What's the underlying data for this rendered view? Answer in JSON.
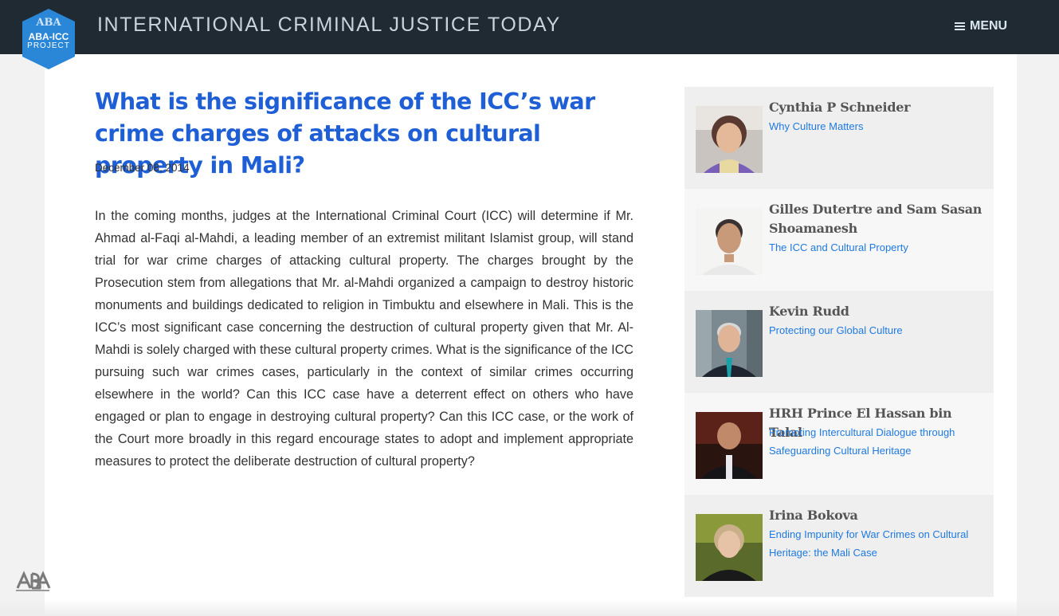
{
  "header": {
    "site_title": "INTERNATIONAL CRIMINAL JUSTICE TODAY",
    "menu_label": "MENU",
    "logo": {
      "line1": "ABA-ICC",
      "line2": "PROJECT"
    }
  },
  "article": {
    "title": "What is the significance of the ICC’s war crime charges of attacks on cultural property in Mali?",
    "date": "December 08, 2014",
    "body": "In the coming months, judges at the International Criminal Court (ICC) will determine if Mr. Ahmad al-Faqi al-Mahdi, a leading member of an extremist militant Islamist group, will stand trial for war crime charges of attacking cultural property. The charges brought by the Prosecution stem from allegations that Mr. al-Mahdi organized a campaign to destroy historic monuments and buildings dedicated to religion in Timbuktu and elsewhere in Mali. This is the ICC’s most significant case concerning the destruction of cultural property given that Mr. Al-Mahdi is solely charged with these cultural property crimes. What is the significance of the ICC pursuing such war crimes cases, particularly in the context of similar crimes occurring elsewhere in the world? Can this ICC case have a deterrent effect on others who have engaged or plan to engage in destroying cultural property?  Can this ICC case, or the work of the Court more broadly in this regard encourage states to adopt and implement appropriate measures to protect the deliberate destruction of cultural property?"
  },
  "sidebar": {
    "items": [
      {
        "name": "Cynthia P Schneider",
        "link": "Why Culture Matters"
      },
      {
        "name": "Gilles Dutertre and Sam Sasan Shoamanesh",
        "link": "The ICC and Cultural Property"
      },
      {
        "name": "Kevin Rudd",
        "link": "Protecting our Global Culture"
      },
      {
        "name": "HRH Prince El Hassan bin Talal",
        "link": "Promoting Intercultural Dialogue through Safeguarding Cultural Heritage"
      },
      {
        "name": "Irina Bokova",
        "link": "Ending Impunity for War Crimes on Cultural Heritage: the Mali Case"
      }
    ]
  },
  "colors": {
    "header_bg": "#1f2a33",
    "title_blue": "#1f5fd6",
    "link_blue": "#1f7ae0",
    "logo_blue": "#2a86d6"
  }
}
